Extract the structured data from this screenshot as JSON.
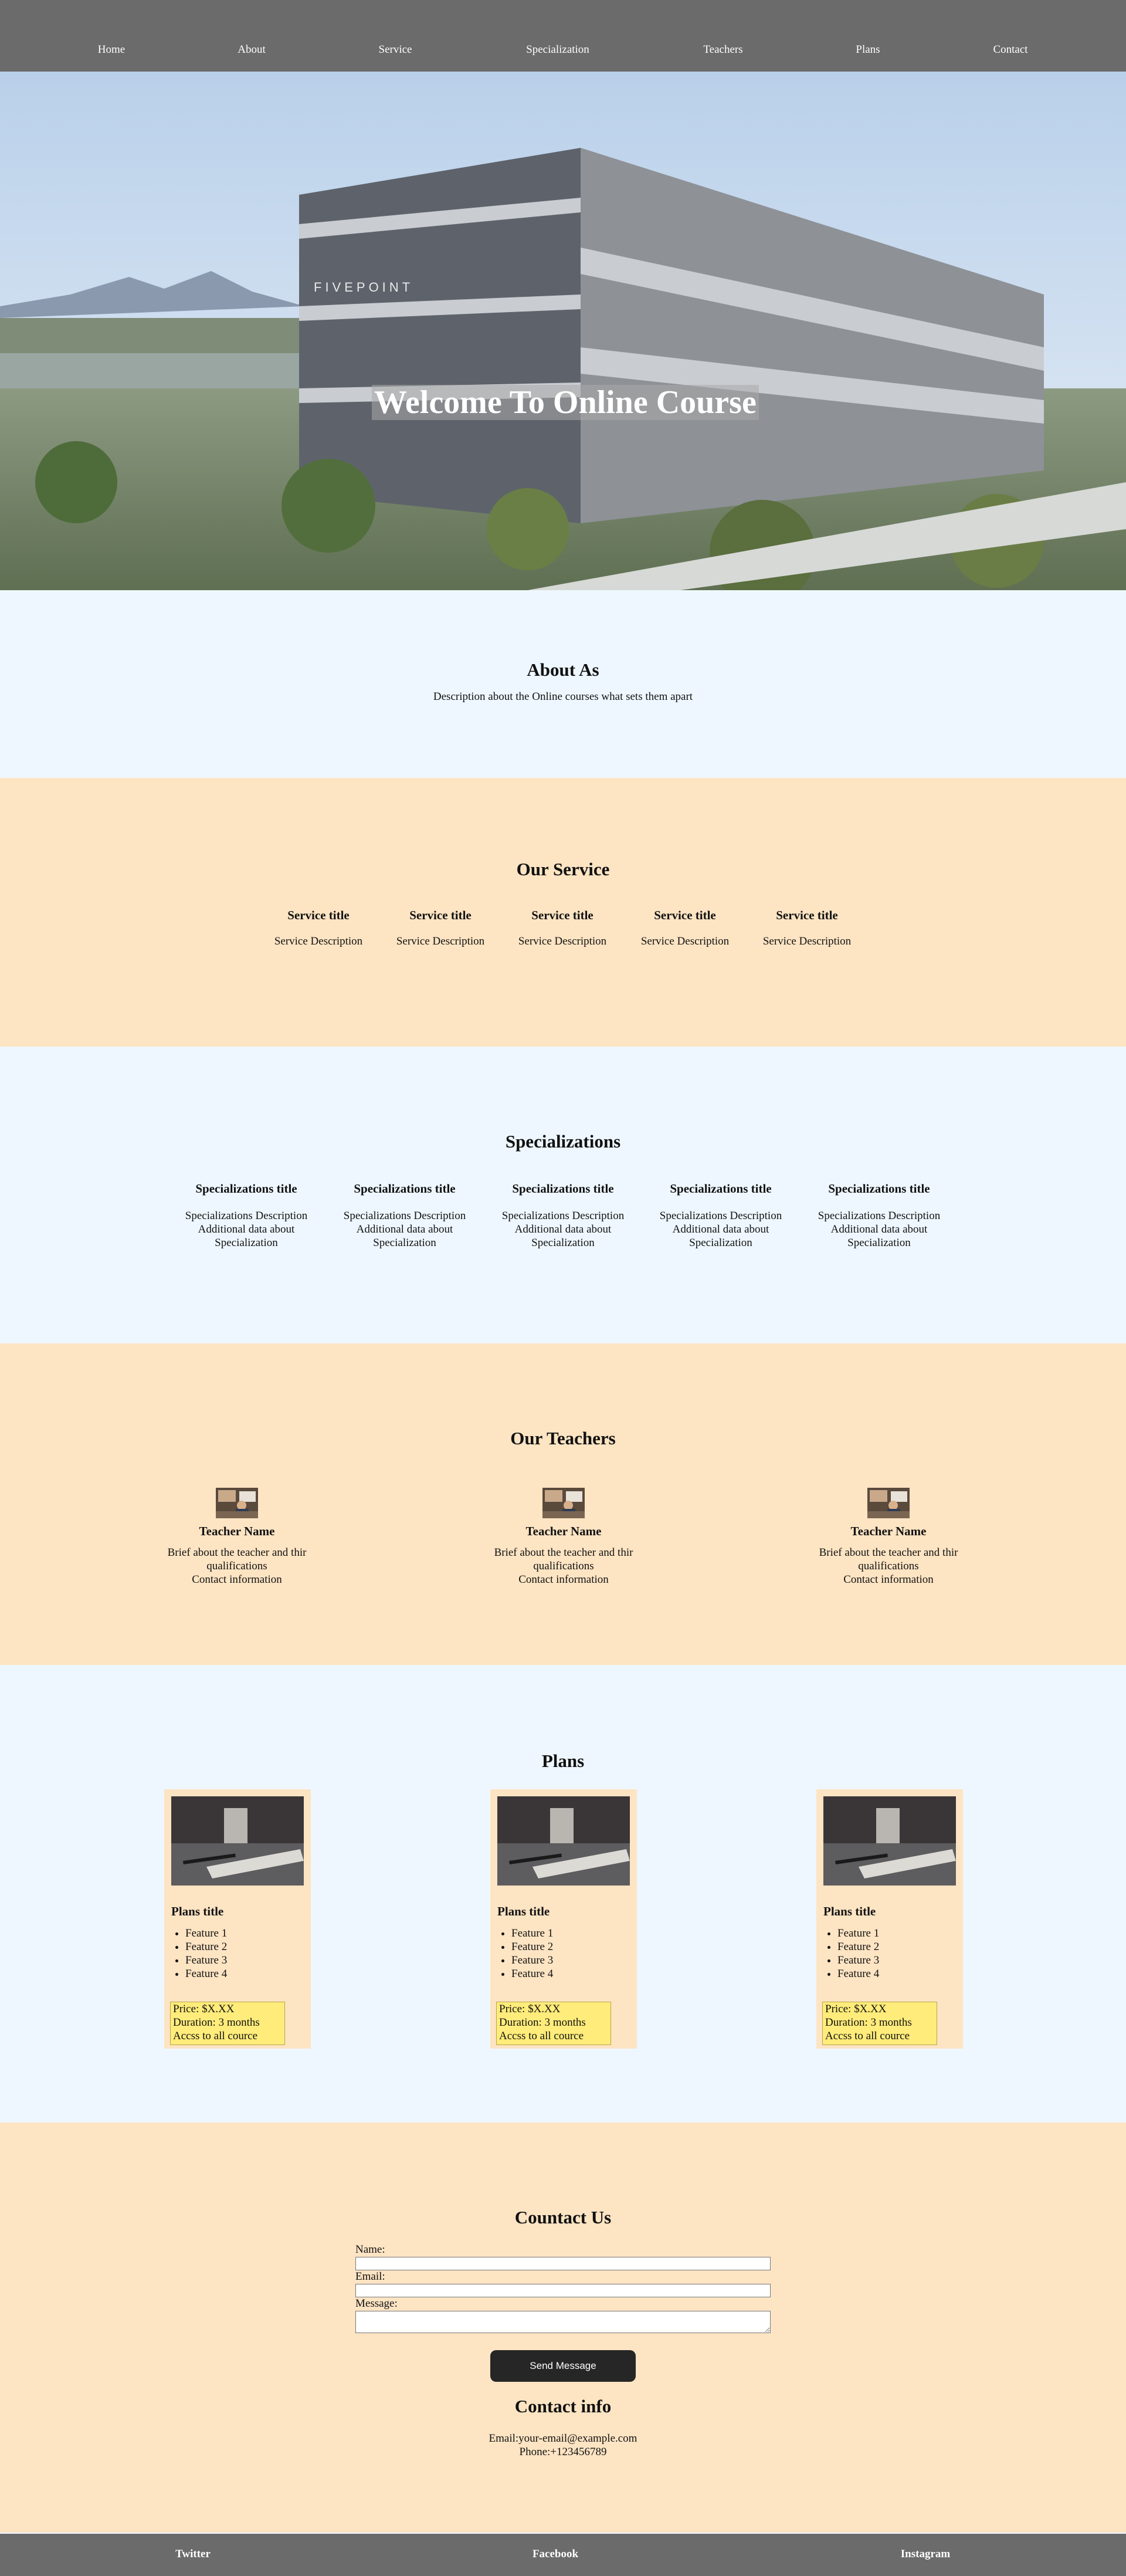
{
  "nav": {
    "items": [
      "Home",
      "About",
      "Service",
      "Specialization",
      "Teachers",
      "Plans",
      "Contact"
    ]
  },
  "hero": {
    "title": "Welcome To Online Course",
    "building_sign": "FIVEPOINT"
  },
  "about": {
    "title": "About As",
    "description": "Description about the Online courses what sets them apart"
  },
  "services": {
    "title": "Our Service",
    "items": [
      {
        "title": "Service title",
        "description": "Service Description"
      },
      {
        "title": "Service title",
        "description": "Service Description"
      },
      {
        "title": "Service title",
        "description": "Service Description"
      },
      {
        "title": "Service title",
        "description": "Service Description"
      },
      {
        "title": "Service title",
        "description": "Service Description"
      }
    ]
  },
  "specializations": {
    "title": "Specializations",
    "items": [
      {
        "title": "Specializations title",
        "description": "Specializations Description",
        "extra_1": "Additional data about",
        "extra_2": "Specialization"
      },
      {
        "title": "Specializations title",
        "description": "Specializations Description",
        "extra_1": "Additional data about",
        "extra_2": "Specialization"
      },
      {
        "title": "Specializations title",
        "description": "Specializations Description",
        "extra_1": "Additional data about",
        "extra_2": "Specialization"
      },
      {
        "title": "Specializations title",
        "description": "Specializations Description",
        "extra_1": "Additional data about",
        "extra_2": "Specialization"
      },
      {
        "title": "Specializations title",
        "description": "Specializations Description",
        "extra_1": "Additional data about",
        "extra_2": "Specialization"
      }
    ]
  },
  "teachers": {
    "title": "Our Teachers",
    "items": [
      {
        "name": "Teacher Name",
        "brief_1": "Brief about the teacher and thir",
        "brief_2": "qualifications",
        "contact": "Contact information"
      },
      {
        "name": "Teacher Name",
        "brief_1": "Brief about the teacher and thir",
        "brief_2": "qualifications",
        "contact": "Contact information"
      },
      {
        "name": "Teacher Name",
        "brief_1": "Brief about the teacher and thir",
        "brief_2": "qualifications",
        "contact": "Contact information"
      }
    ]
  },
  "plans": {
    "title": "Plans",
    "items": [
      {
        "title": "Plans title",
        "features": [
          "Feature 1",
          "Feature 2",
          "Feature 3",
          "Feature 4"
        ],
        "price": "Price: $X.XX",
        "duration": "Duration: 3 months",
        "access": "Accss to all cource"
      },
      {
        "title": "Plans title",
        "features": [
          "Feature 1",
          "Feature 2",
          "Feature 3",
          "Feature 4"
        ],
        "price": "Price: $X.XX",
        "duration": "Duration: 3 months",
        "access": "Accss to all cource"
      },
      {
        "title": "Plans title",
        "features": [
          "Feature 1",
          "Feature 2",
          "Feature 3",
          "Feature 4"
        ],
        "price": "Price: $X.XX",
        "duration": "Duration: 3 months",
        "access": "Accss to all cource"
      }
    ]
  },
  "contact": {
    "title": "Countact Us",
    "name_label": "Name:",
    "email_label": "Email:",
    "message_label": "Message:",
    "name_value": "",
    "email_value": "",
    "message_value": "",
    "send_label": "Send Message",
    "info_title": "Contact info",
    "email_line": "Email:your-email@example.com",
    "phone_line": "Phone:+123456789"
  },
  "footer": {
    "links": [
      "Twitter",
      "Facebook",
      "Instagram"
    ]
  },
  "colors": {
    "nav_bg": "#6b6b6b",
    "blue_section": "#eef7ff",
    "peach_section": "#fde4c3",
    "price_box": "#ffec7a",
    "button_bg": "#262626"
  }
}
